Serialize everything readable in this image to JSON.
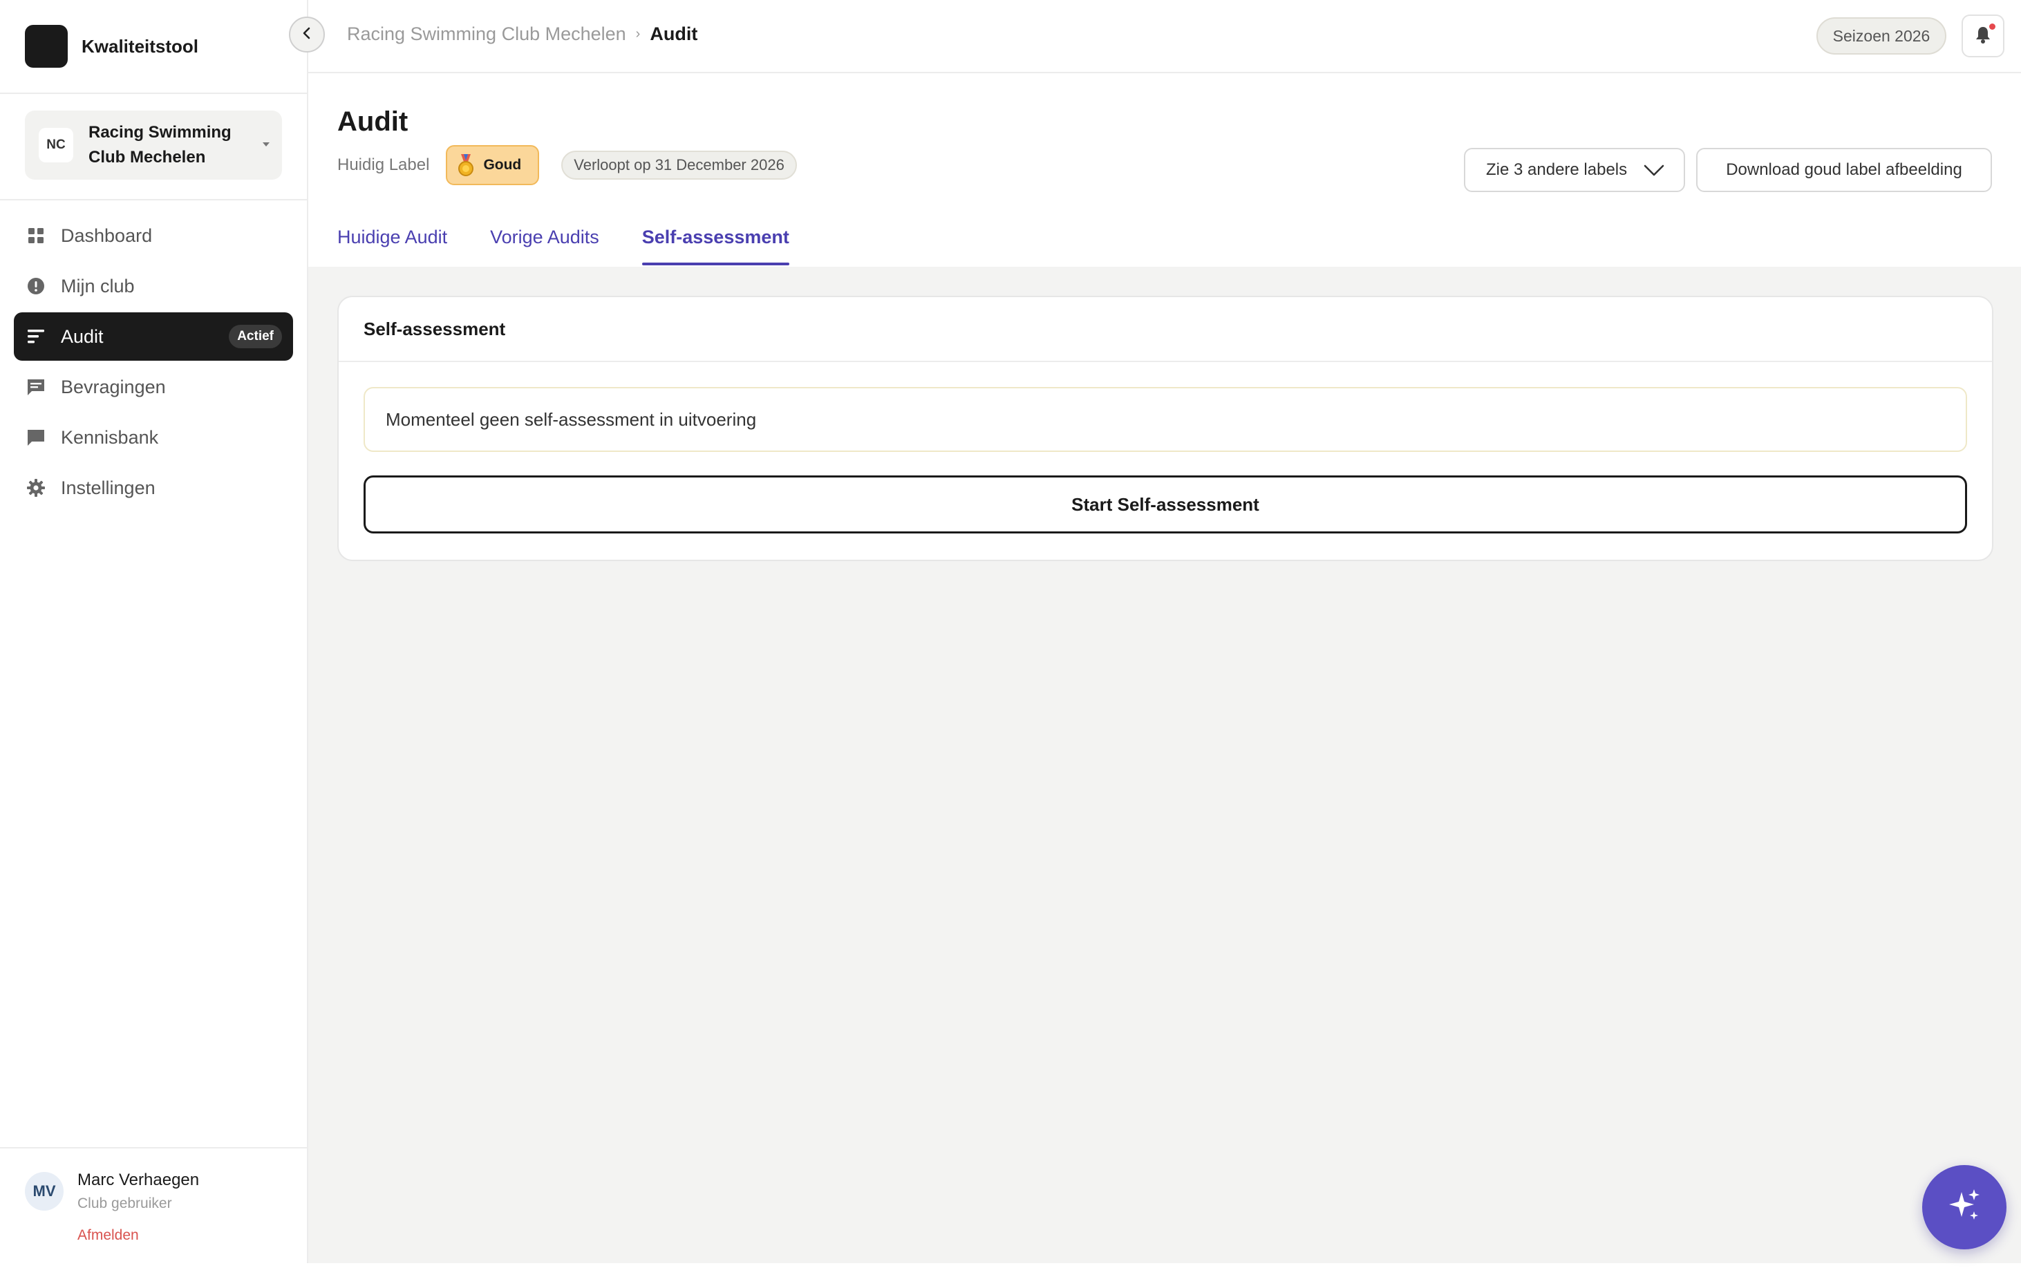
{
  "brand": {
    "name": "Kwaliteitstool"
  },
  "org": {
    "initials": "NC",
    "name": "Racing Swimming Club Mechelen"
  },
  "nav": {
    "items": [
      {
        "label": "Dashboard",
        "icon": "grid-icon"
      },
      {
        "label": "Mijn club",
        "icon": "alert-circle-icon"
      },
      {
        "label": "Audit",
        "icon": "list-icon",
        "badge": "Actief",
        "active": true
      },
      {
        "label": "Bevragingen",
        "icon": "message-icon"
      },
      {
        "label": "Kennisbank",
        "icon": "chat-icon"
      },
      {
        "label": "Instellingen",
        "icon": "gear-icon"
      }
    ]
  },
  "user": {
    "initials": "MV",
    "name": "Marc Verhaegen",
    "role": "Club gebruiker",
    "logout": "Afmelden"
  },
  "breadcrumb": {
    "parent": "Racing Swimming Club Mechelen",
    "separator": "›",
    "current": "Audit"
  },
  "topbar": {
    "season": "Seizoen 2026"
  },
  "page": {
    "title": "Audit",
    "label_caption": "Huidig Label",
    "label_name": "Goud",
    "expiry": "Verloopt op 31 December 2026",
    "other_labels_button": "Zie 3 andere labels",
    "download_button": "Download goud label afbeelding"
  },
  "tabs": [
    {
      "label": "Huidige Audit",
      "active": false
    },
    {
      "label": "Vorige Audits",
      "active": false
    },
    {
      "label": "Self-assessment",
      "active": true
    }
  ],
  "card": {
    "title": "Self-assessment",
    "notice": "Momenteel geen self-assessment in uitvoering",
    "start_button": "Start Self-assessment"
  },
  "colors": {
    "accent": "#4a3fb0",
    "badge_gold": "#fbd79a",
    "fab": "#5b4fc4",
    "notification": "#e5484d",
    "logout": "#d9534f"
  }
}
